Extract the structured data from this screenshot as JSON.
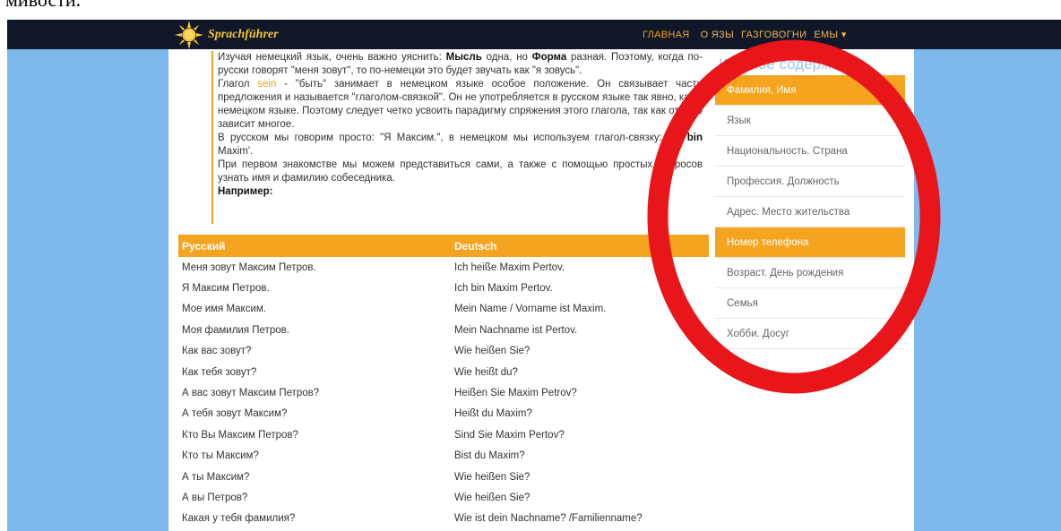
{
  "caption": {
    "cropped_text": "мивости."
  },
  "brand": {
    "name": "Sprachführer"
  },
  "nav": {
    "home": "ГЛАВНАЯ",
    "items": [
      "О ЯЗЫ",
      "ГАЗГОВОГНИ",
      "ЕМЫ ▾"
    ]
  },
  "intro": {
    "p1": {
      "a": "Изучая немецкий язык, очень важно уяснить: ",
      "b1": "Мысль",
      "c": " одна, но ",
      "b2": "Форма",
      "d": " разная. Поэтому, когда по-русски говорят \"меня зовут\", то по-немецки это будет звучать как \"я зовусь\"."
    },
    "p2": {
      "a": "Глагол ",
      "verb": "sein",
      "b": " - \"быть\" занимает в немецком языке особое положение. Он связывает части предложения и называется \"глаголом-связкой\". Он не употребляется в русском языке так явно, как в немецком языке. Поэтому следует четко усвоить парадигму спряжения этого глагола, так как от него зависит многое."
    },
    "p3": {
      "a": "В русском мы говорим просто: \"Я Максим.\", в немецком мы используем глагол-связку: Ich ",
      "b": "bin",
      "c": " Maxim'."
    },
    "p4": "При первом знакомстве мы можем представиться сами, а также с помощью простых вопросов узнать имя и фамилию собеседника.",
    "example": "Например:"
  },
  "table": {
    "headers": [
      "Русский",
      "Deutsch"
    ],
    "rows": [
      [
        "Меня зовут Максим Петров.",
        "Ich heiße Maxim Pertov."
      ],
      [
        "Я Максим Петров.",
        "Ich bin Maxim Pertov."
      ],
      [
        "Мое имя Максим.",
        "Mein Name / Vorname ist Maxim."
      ],
      [
        "Моя фамилия Петров.",
        "Mein Nachname ist Pertov."
      ],
      [
        "Как вас зовут?",
        "Wie heißen Sie?"
      ],
      [
        "Как тебя зовут?",
        "Wie heißt du?"
      ],
      [
        "А вас зовут Максим Петров?",
        "Heißen Sie Maxim Petrov?"
      ],
      [
        "А тебя зовут Максим?",
        "Heißt du Maxim?"
      ],
      [
        "Кто Вы Максим Петров?",
        "Sind Sie Maxim Pertov?"
      ],
      [
        "Кто ты Максим?",
        "Bist du Maxim?"
      ],
      [
        "А ты Максим?",
        "Wie heißen Sie?"
      ],
      [
        "А вы Петров?",
        "Wie heißen Sie?"
      ],
      [
        "Какая у тебя фамилия?",
        "Wie ist dein Nachname? /Familienname?"
      ]
    ]
  },
  "toc": {
    "title": "Краткое содержание",
    "items": [
      "Фамилия, Имя",
      "Язык",
      "Национальность. Страна",
      "Профессия. Должность",
      "Адрес. Место жительства",
      "Номер телефона",
      "Возраст. День рождения",
      "Семья",
      "Хобби. Досуг"
    ],
    "active_indices": [
      0,
      5
    ]
  },
  "colors": {
    "accent": "#f5a420",
    "navbar": "#0f1729",
    "page_bg": "#7db9ec",
    "annotation_ring": "#e8161b"
  },
  "icons": {
    "logo": "sun-icon"
  }
}
